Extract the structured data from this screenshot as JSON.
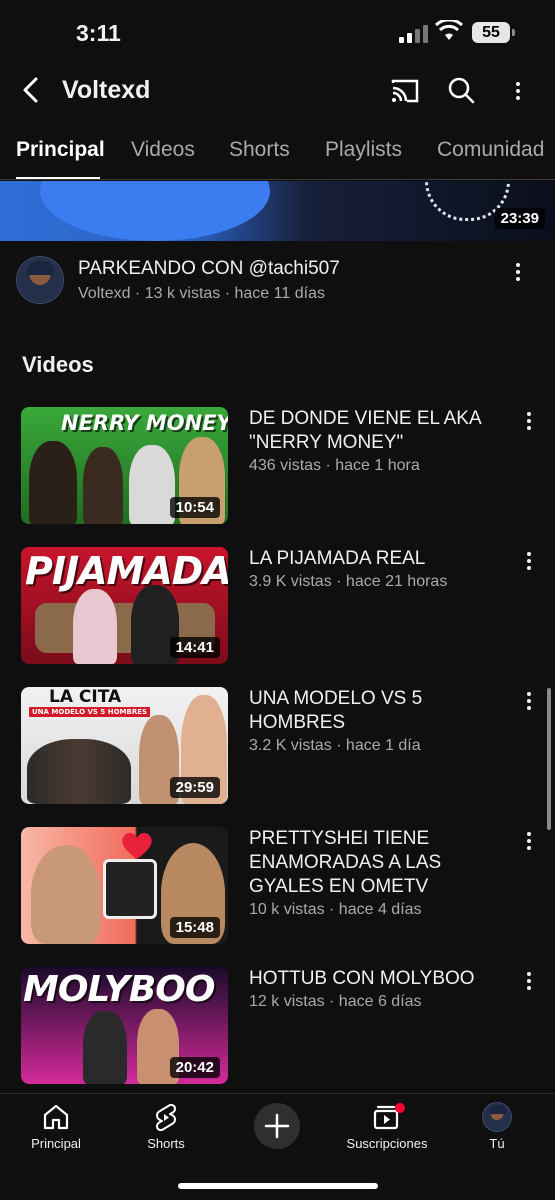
{
  "status_bar": {
    "time": "3:11",
    "battery": "55"
  },
  "header": {
    "channel_name": "Voltexd",
    "icons": [
      "back-arrow-icon",
      "cast-icon",
      "search-icon",
      "more-vert-icon"
    ]
  },
  "tabs": [
    {
      "label": "Principal",
      "active": true
    },
    {
      "label": "Videos",
      "active": false
    },
    {
      "label": "Shorts",
      "active": false
    },
    {
      "label": "Playlists",
      "active": false
    },
    {
      "label": "Comunidad",
      "active": false
    }
  ],
  "featured": {
    "duration": "23:39",
    "title": "PARKEANDO CON @tachi507",
    "meta": "Voltexd · 13 k vistas · hace 11 días"
  },
  "section_title": "Videos",
  "videos": [
    {
      "title": "DE DONDE VIENE EL AKA \"NERRY MONEY\"",
      "meta": "436 vistas · hace 1 hora",
      "duration": "10:54",
      "thumb_text": "NERRY MONEY",
      "thumb_color": "#2f8f2f"
    },
    {
      "title": "LA PIJAMADA REAL",
      "meta": "3.9 K vistas · hace 21 horas",
      "duration": "14:41",
      "thumb_text": "PIJAMADA",
      "thumb_color": "#b3122a"
    },
    {
      "title": "UNA MODELO VS 5 HOMBRES",
      "meta": "3.2 K vistas · hace 1 día",
      "duration": "29:59",
      "thumb_text": "LA CITA",
      "thumb_subtext": "UNA MODELO VS 5 HOMBRES",
      "thumb_color": "#e9e9e9"
    },
    {
      "title": "PRETTYSHEI TIENE ENAMORADAS A LAS GYALES EN OMETV",
      "meta": "10 k vistas · hace 4 días",
      "duration": "15:48",
      "thumb_color": "#f26b5a"
    },
    {
      "title": "HOTTUB CON MOLYBOO",
      "meta": "12 k vistas · hace 6 días",
      "duration": "20:42",
      "thumb_text": "MOLYBOO",
      "thumb_color": "#d42a9a"
    }
  ],
  "bottom_nav": [
    {
      "label": "Principal",
      "icon": "home-icon"
    },
    {
      "label": "Shorts",
      "icon": "shorts-icon"
    },
    {
      "label": "",
      "icon": "create-plus-icon"
    },
    {
      "label": "Suscripciones",
      "icon": "subscriptions-icon"
    },
    {
      "label": "Tú",
      "icon": "profile-avatar-icon"
    }
  ],
  "colors": {
    "background": "#0f0f0f",
    "secondary_text": "#aaaaaa",
    "accent_red": "#ff0033"
  }
}
